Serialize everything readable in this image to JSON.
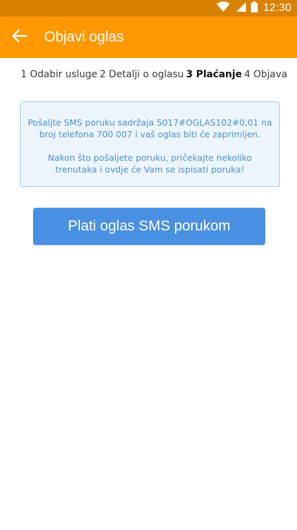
{
  "status_bar": {
    "time": "12:30",
    "icons": [
      "wifi-icon",
      "signal-icon",
      "battery-icon"
    ]
  },
  "app_bar": {
    "title": "Objavi oglas",
    "back_icon": "arrow-left-icon"
  },
  "steps": [
    {
      "label": "1 Odabir usluge",
      "active": false
    },
    {
      "label": "2 Detalji o oglasu",
      "active": false
    },
    {
      "label": "3 Plaćanje",
      "active": true
    },
    {
      "label": "4 Objava",
      "active": false
    }
  ],
  "info": {
    "line1": "Pošaljte SMS poruku sadržaja 5017#OGLAS102#0,01 na broj telefona 700 007 i vaš oglas biti će zaprimljen.",
    "line2": "Nakon što pošaljete poruku, pričekajte nekoliko trenutaka i ovdje će Vam se ispisati poruka!"
  },
  "button": {
    "label": "Plati oglas SMS porukom"
  },
  "colors": {
    "status_bar": "#d98100",
    "app_bar": "#ff9800",
    "info_text": "#4a8fd2",
    "info_border": "#9cc8ec",
    "info_bg": "#edf5fc",
    "button_bg": "#4a90e2"
  }
}
